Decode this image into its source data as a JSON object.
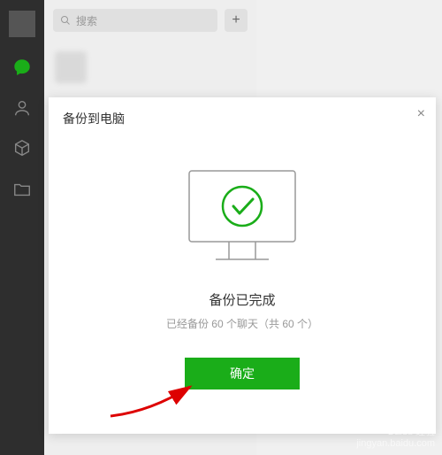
{
  "sidebar": {
    "chat_icon": "chat",
    "contacts_icon": "contacts",
    "files_icon": "files",
    "folder_icon": "folder"
  },
  "search": {
    "placeholder": "搜索"
  },
  "dialog": {
    "title": "备份到电脑",
    "done_title": "备份已完成",
    "done_sub": "已经备份 60 个聊天（共 60 个）",
    "ok_label": "确定"
  },
  "watermark": {
    "line1": "Baidu 经验",
    "line2": "jingyan.baidu.com"
  }
}
